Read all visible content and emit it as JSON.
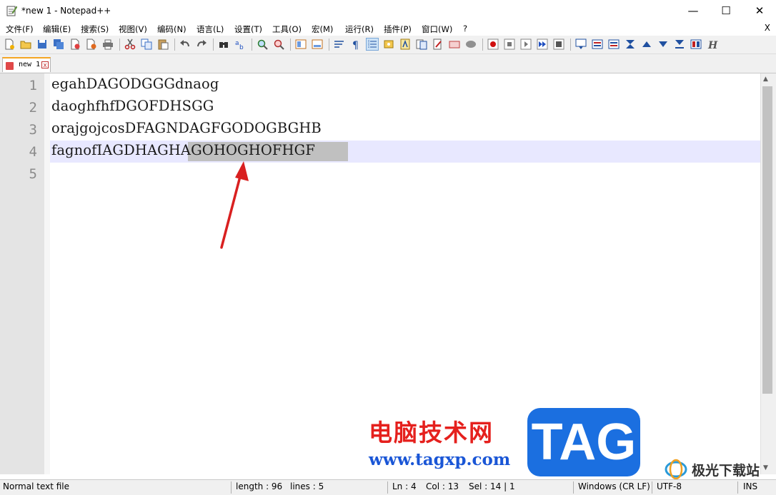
{
  "window": {
    "title": "*new 1 - Notepad++",
    "minimize_glyph": "—",
    "maximize_glyph": "☐",
    "close_glyph": "✕"
  },
  "menu": {
    "items": [
      "文件(F)",
      "编辑(E)",
      "搜索(S)",
      "视图(V)",
      "编码(N)",
      "语言(L)",
      "设置(T)",
      "工具(O)",
      "宏(M)",
      "运行(R)",
      "插件(P)",
      "窗口(W)",
      "?"
    ],
    "close_label": "X"
  },
  "toolbar": {
    "icons": [
      "new-file-icon",
      "open-file-icon",
      "save-icon",
      "save-all-icon",
      "close-icon",
      "close-all-icon",
      "print-icon",
      "cut-icon",
      "copy-icon",
      "paste-icon",
      "undo-icon",
      "redo-icon",
      "find-icon",
      "replace-icon",
      "zoom-in-icon",
      "zoom-out-icon",
      "sync-v-icon",
      "sync-h-icon",
      "word-wrap-icon",
      "show-all-chars-icon",
      "indent-guide-icon",
      "doc-map-icon",
      "function-list-icon",
      "folder-workspace-icon",
      "monitoring-icon",
      "record-macro-icon",
      "stop-macro-icon",
      "play-macro-icon",
      "run-macro-multiple-icon",
      "save-macro-icon",
      "trim-icon",
      "bookmark-icon",
      "spell-icon",
      "arrow-up-icon",
      "arrow-down-icon",
      "filter-icon",
      "compare-icon",
      "hex-icon"
    ]
  },
  "tab": {
    "label": "new 1",
    "close_glyph": "x"
  },
  "editor": {
    "line_numbers": [
      "1",
      "2",
      "3",
      "4",
      "5"
    ],
    "lines": [
      "egahDAGODGGGdnaog",
      "daoghfhfDGOFDHSGG",
      "orajgojcosDFAGNDAGFGODOGBGHB",
      "fagnofIAGDHAGHAGOHOGHOFHGF",
      ""
    ],
    "current_line": 4
  },
  "status": {
    "file_type": "Normal text file",
    "length": "length : 96",
    "lines": "lines : 5",
    "ln": "Ln : 4",
    "col": "Col : 13",
    "sel": "Sel : 14 | 1",
    "eol": "Windows (CR LF)",
    "encoding": "UTF-8",
    "mode": "INS"
  },
  "watermark": {
    "site_cn": "电脑技术网",
    "url": "www.tagxp.com",
    "tag": "TAG",
    "corner": "极光下载站"
  },
  "colors": {
    "accent_tab": "#f5a623",
    "current_line": "#e8e8ff",
    "selection": "#c0c0c0",
    "annotation_arrow": "#d92020"
  }
}
